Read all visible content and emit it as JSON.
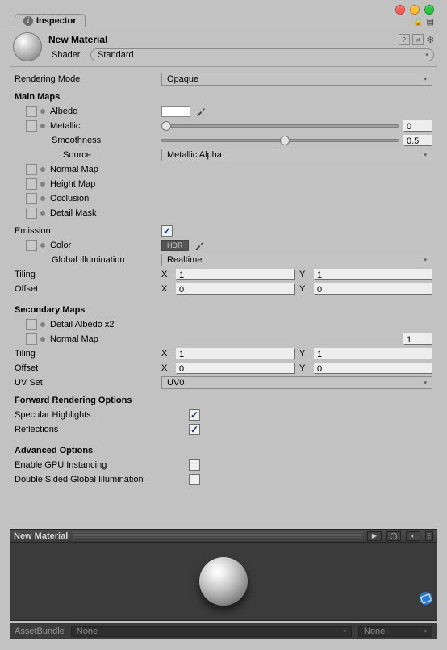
{
  "tab": {
    "label": "Inspector"
  },
  "header": {
    "title": "New Material",
    "shader_label": "Shader",
    "shader_value": "Standard"
  },
  "rendering_mode": {
    "label": "Rendering Mode",
    "value": "Opaque"
  },
  "main_maps": {
    "title": "Main Maps",
    "albedo": {
      "label": "Albedo"
    },
    "metallic": {
      "label": "Metallic",
      "value": "0"
    },
    "smoothness": {
      "label": "Smoothness",
      "value": "0.5"
    },
    "source": {
      "label": "Source",
      "value": "Metallic Alpha"
    },
    "normal_map": {
      "label": "Normal Map"
    },
    "height_map": {
      "label": "Height Map"
    },
    "occlusion": {
      "label": "Occlusion"
    },
    "detail_mask": {
      "label": "Detail Mask"
    }
  },
  "emission": {
    "label": "Emission",
    "color_label": "Color",
    "hdr": "HDR",
    "gi_label": "Global Illumination",
    "gi_value": "Realtime"
  },
  "tiling": {
    "label": "Tiling",
    "x_label": "X",
    "y_label": "Y",
    "x": "1",
    "y": "1"
  },
  "offset": {
    "label": "Offset",
    "x_label": "X",
    "y_label": "Y",
    "x": "0",
    "y": "0"
  },
  "secondary": {
    "title": "Secondary Maps",
    "detail_albedo": {
      "label": "Detail Albedo x2"
    },
    "normal_map": {
      "label": "Normal Map",
      "value": "1"
    },
    "tiling": {
      "label": "Tiling",
      "x_label": "X",
      "y_label": "Y",
      "x": "1",
      "y": "1"
    },
    "offset": {
      "label": "Offset",
      "x_label": "X",
      "y_label": "Y",
      "x": "0",
      "y": "0"
    },
    "uvset": {
      "label": "UV Set",
      "value": "UV0"
    }
  },
  "forward": {
    "title": "Forward Rendering Options",
    "spec": {
      "label": "Specular Highlights"
    },
    "reflections": {
      "label": "Reflections"
    }
  },
  "advanced": {
    "title": "Advanced Options",
    "gpu": {
      "label": "Enable GPU Instancing"
    },
    "dsgi": {
      "label": "Double Sided Global Illumination"
    }
  },
  "preview": {
    "title": "New Material"
  },
  "assetbundle": {
    "label": "AssetBundle",
    "value": "None",
    "variant": "None"
  }
}
